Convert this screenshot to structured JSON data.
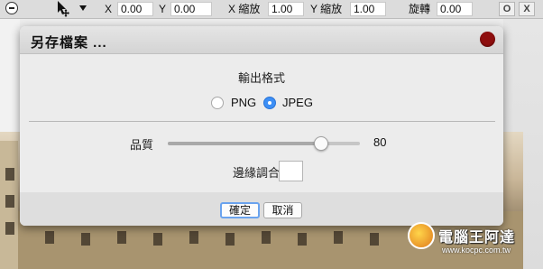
{
  "toolbar": {
    "x_label": "X",
    "x_value": "0.00",
    "y_label": "Y",
    "y_value": "0.00",
    "scale_x_label": "X 縮放",
    "scale_x_value": "1.00",
    "scale_y_label": "Y 縮放",
    "scale_y_value": "1.00",
    "rotate_label": "旋轉",
    "rotate_value": "0.00",
    "btn_o": "O",
    "btn_x": "X"
  },
  "dialog": {
    "title": "另存檔案 ...",
    "format_heading": "輸出格式",
    "formats": [
      {
        "label": "PNG",
        "selected": false
      },
      {
        "label": "JPEG",
        "selected": true
      }
    ],
    "quality_label": "品質",
    "quality_value": "80",
    "quality_fraction": 0.8,
    "edge_label": "邊緣調合",
    "ok_label": "確定",
    "cancel_label": "取消"
  },
  "watermark": {
    "brand": "電腦王阿達",
    "url": "www.kocpc.com.tw"
  },
  "colors": {
    "accent": "#3d8ff5",
    "close": "#8e0e0e"
  }
}
